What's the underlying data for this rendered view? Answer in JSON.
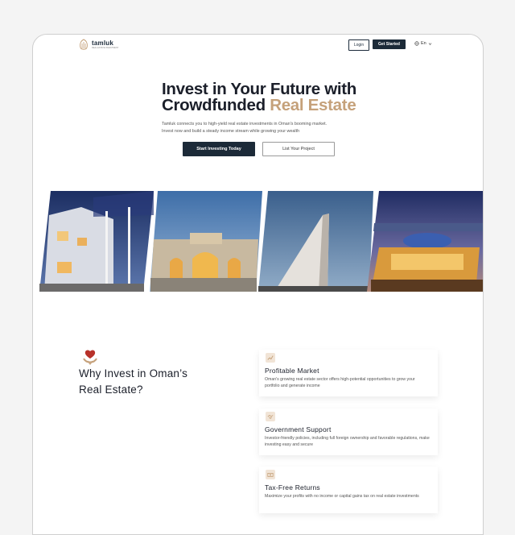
{
  "header": {
    "logo_name": "tamluk",
    "logo_tagline": "REAL ESTATE INVESTMENT",
    "login_label": "Login",
    "get_started_label": "Get Started",
    "language_label": "En",
    "language_icon": "globe-icon"
  },
  "hero": {
    "title_line1": "Invest in Your Future with",
    "title_line2_plain": "Crowdfunded ",
    "title_line2_accent": "Real Estate",
    "subtitle": "Tamluk connects you to high-yield real estate investments in Oman's booming market. Invest now and build a steady income stream while growing your wealth",
    "primary_cta": "Start Investing Today",
    "secondary_cta": "List Your Project"
  },
  "gallery": {
    "images": [
      "villa-night-image",
      "palace-courtyard-image",
      "modern-tower-image",
      "waterfront-resort-image"
    ]
  },
  "why": {
    "title_line1": "Why Invest in Oman’s",
    "title_line2": "Real Estate?",
    "cards": [
      {
        "icon": "chart-icon",
        "title": "Profitable Market",
        "desc": "Oman's growing real estate sector offers high-potential opportunities to grow your portfolio and generate income"
      },
      {
        "icon": "handshake-icon",
        "title": "Government Support",
        "desc": "Investor-friendly policies, including full foreign ownership and favorable regulations, make investing easy and secure"
      },
      {
        "icon": "money-icon",
        "title": "Tax-Free Returns",
        "desc": "Maximize your profits with no income or capital gains tax on real estate investments"
      }
    ]
  },
  "colors": {
    "navy": "#1c2a38",
    "gold": "#c5a17a"
  }
}
